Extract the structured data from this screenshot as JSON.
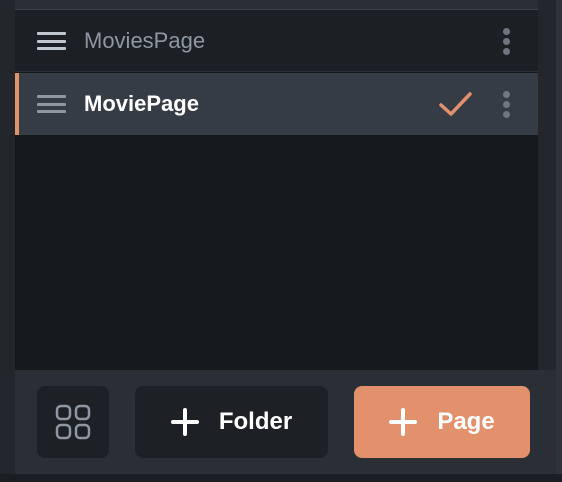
{
  "pages": [
    {
      "label": "MoviesPage",
      "selected": false
    },
    {
      "label": "MoviePage",
      "selected": true
    }
  ],
  "icons": {
    "drag_handle": "hamburger-icon",
    "selected_marker": "check-icon",
    "row_menu": "more-vertical-icon",
    "grid": "grid-icon",
    "add": "plus-icon"
  },
  "actions": {
    "grid_view": "",
    "add_folder_label": "Folder",
    "add_page_label": "Page"
  },
  "colors": {
    "accent": "#e2916c",
    "panel_bg": "#16191c",
    "selected_row_bg": "#363c45",
    "bar_bg": "#2a2f35",
    "button_bg": "#1d2024"
  }
}
